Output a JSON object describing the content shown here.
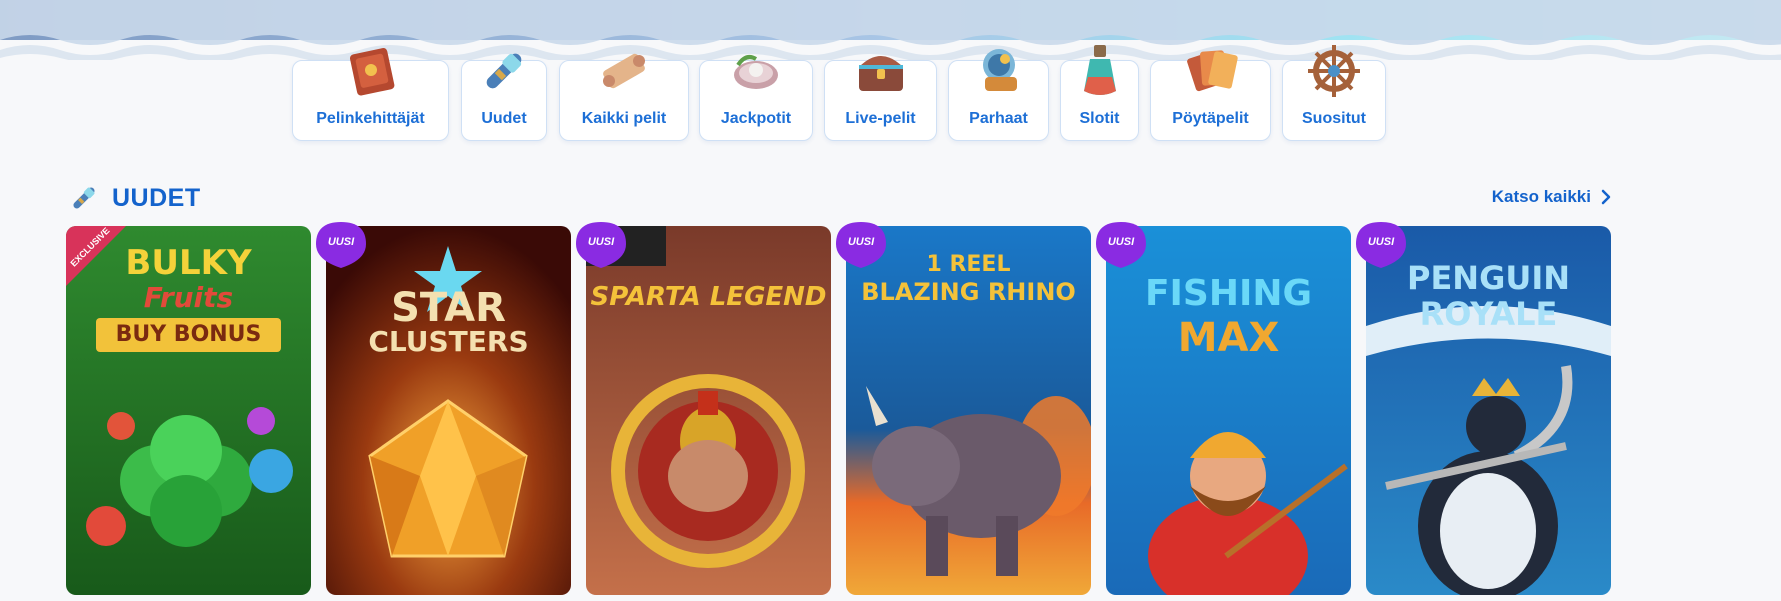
{
  "categories": [
    {
      "label": "Pelinkehittäjät",
      "icon": "spellbook-icon"
    },
    {
      "label": "Uudet",
      "icon": "spyglass-icon"
    },
    {
      "label": "Kaikki pelit",
      "icon": "scroll-map-icon"
    },
    {
      "label": "Jackpotit",
      "icon": "pearl-shell-icon"
    },
    {
      "label": "Live-pelit",
      "icon": "treasure-chest-icon"
    },
    {
      "label": "Parhaat",
      "icon": "trophy-compass-icon"
    },
    {
      "label": "Slotit",
      "icon": "potion-bottle-icon"
    },
    {
      "label": "Pöytäpelit",
      "icon": "playing-cards-icon"
    },
    {
      "label": "Suositut",
      "icon": "ship-wheel-icon"
    }
  ],
  "section": {
    "title": "UUDET",
    "icon": "spyglass-icon",
    "see_all_label": "Katso kaikki"
  },
  "games": [
    {
      "title_lines": [
        "BULKY",
        "Fruits",
        "BUY BONUS"
      ],
      "ribbon": "EXCLUSIVE",
      "badge": ""
    },
    {
      "title_lines": [
        "STAR",
        "CLUSTERS"
      ],
      "ribbon": "",
      "badge": "UUSI"
    },
    {
      "title_lines": [
        "SPARTA LEGEND"
      ],
      "ribbon": "",
      "badge": "UUSI"
    },
    {
      "title_lines": [
        "1 REEL",
        "BLAZING RHINO"
      ],
      "ribbon": "",
      "badge": "UUSI"
    },
    {
      "title_lines": [
        "FISHING",
        "MAX"
      ],
      "ribbon": "",
      "badge": "UUSI"
    },
    {
      "title_lines": [
        "PENGUIN",
        "ROYALE"
      ],
      "ribbon": "",
      "badge": "UUSI"
    }
  ],
  "colors": {
    "accent": "#1463cc",
    "category_label": "#1d6fd6",
    "badge": "#8a2be2"
  }
}
